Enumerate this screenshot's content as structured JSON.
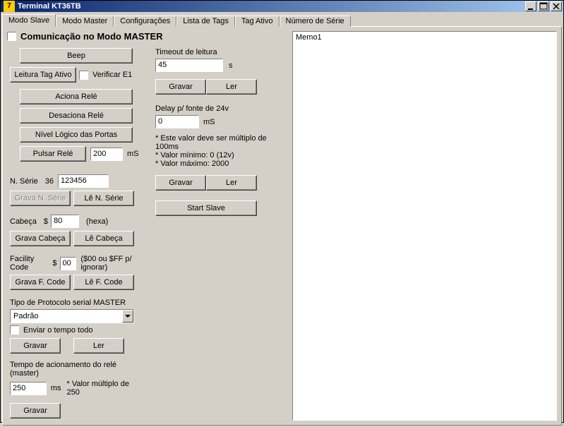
{
  "title": "Terminal KT36TB",
  "tabs": [
    "Modo Slave",
    "Modo Master",
    "Configurações",
    "Lista de Tags",
    "Tag Ativo",
    "Número de Série"
  ],
  "heading": "Comunicação no Modo MASTER",
  "left": {
    "beep": "Beep",
    "leitura_tag_ativo": "Leitura Tag Ativo",
    "verificar_e1": "Verificar E1",
    "aciona_rele": "Aciona Relé",
    "desaciona_rele": "Desaciona Relé",
    "nivel_logico": "Nível Lógico das Portas",
    "pulsar_rele": "Pulsar Relé",
    "pulsar_val": "200",
    "pulsar_unit": "mS",
    "nserie_lbl": "N. Série",
    "nserie_36": "36",
    "nserie_val": "123456",
    "grava_nserie": "Grava N. Série",
    "le_nserie": "Lê N. Série",
    "cabeca_lbl": "Cabeça",
    "cabeca_dollar": "$",
    "cabeca_val": "80",
    "cabeca_hexa": "(hexa)",
    "grava_cabeca": "Grava Cabeça",
    "le_cabeca": "Lê Cabeça",
    "facility_lbl": "Facility Code",
    "facility_dollar": "$",
    "facility_val": "00",
    "facility_note": "($00 ou $FF p/ ignorar)",
    "grava_fcode": "Grava F. Code",
    "le_fcode": "Lê F. Code",
    "protocolo_lbl": "Tipo de Protocolo serial MASTER",
    "protocolo_val": "Padrão",
    "enviar_tempo": "Enviar o tempo todo",
    "gravar": "Gravar",
    "ler": "Ler",
    "tempo_rele_lbl": "Tempo de acionamento do relé (master)",
    "tempo_rele_val": "250",
    "tempo_rele_unit": "ms",
    "tempo_rele_note": "* Valor múltiplo de 250"
  },
  "mid": {
    "timeout_lbl": "Timeout de leitura",
    "timeout_val": "45",
    "timeout_unit": "s",
    "gravar": "Gravar",
    "ler": "Ler",
    "delay_lbl": "Delay p/ fonte de 24v",
    "delay_val": "0",
    "delay_unit": "mS",
    "note1": "* Este valor deve ser múltiplo de 100ms",
    "note2": "* Valor mínimo: 0 (12v)",
    "note3": "* Valor máximo: 2000",
    "start_slave": "Start Slave"
  },
  "memo": "Memo1"
}
